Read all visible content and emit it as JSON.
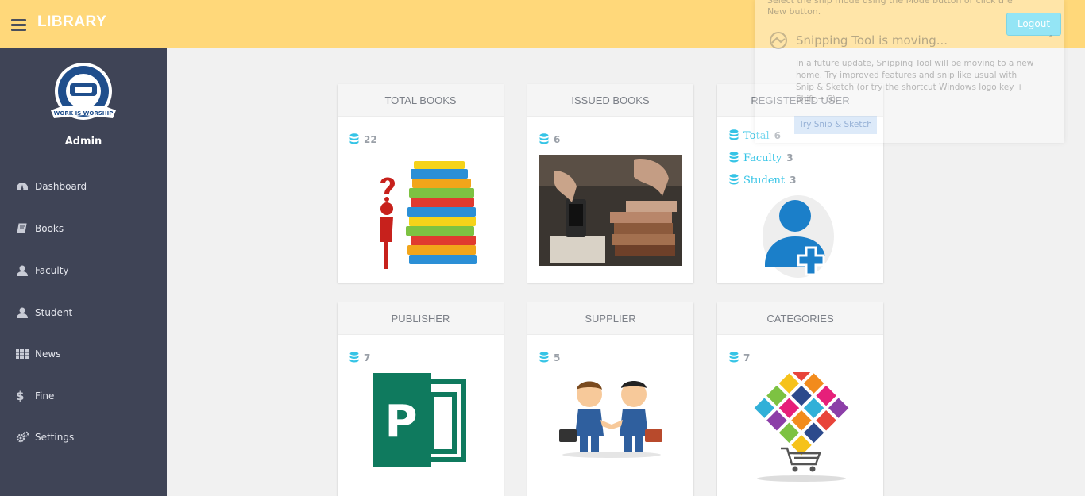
{
  "header": {
    "brand": "LIBRARY",
    "logout_label": "Logout"
  },
  "sidebar": {
    "user_name": "Admin",
    "logo_text": "WORK IS WORSHIP",
    "items": [
      {
        "label": "Dashboard",
        "icon": "dashboard-icon"
      },
      {
        "label": "Books",
        "icon": "book-icon"
      },
      {
        "label": "Faculty",
        "icon": "user-icon"
      },
      {
        "label": "Student",
        "icon": "user-icon"
      },
      {
        "label": "News",
        "icon": "grid-icon"
      },
      {
        "label": "Fine",
        "icon": "dollar-icon"
      },
      {
        "label": "Settings",
        "icon": "gears-icon"
      }
    ]
  },
  "cards": {
    "total_books": {
      "title": "TOTAL BOOKS",
      "count": "22"
    },
    "issued_books": {
      "title": "ISSUED BOOKS",
      "count": "6"
    },
    "registered_user": {
      "title": "REGISTERED USER",
      "total_label": "Total",
      "total": "6",
      "faculty_label": "Faculty",
      "faculty": "3",
      "student_label": "Student",
      "student": "3"
    },
    "publisher": {
      "title": "PUBLISHER",
      "count": "7"
    },
    "supplier": {
      "title": "SUPPLIER",
      "count": "5"
    },
    "categories": {
      "title": "CATEGORIES",
      "count": "7"
    }
  },
  "snip_overlay": {
    "top_text": "Select the snip mode using the Mode button or click the New button.",
    "title": "Snipping Tool is moving...",
    "body": "In a future update, Snipping Tool will be moving to a new home. Try improved features and snip like usual with Snip & Sketch (or try the shortcut Windows logo key + Shift + S).",
    "button": "Try Snip & Sketch"
  },
  "colors": {
    "topbar": "#ffd87a",
    "sidebar": "#3f4456",
    "accent": "#5bd8f0"
  }
}
